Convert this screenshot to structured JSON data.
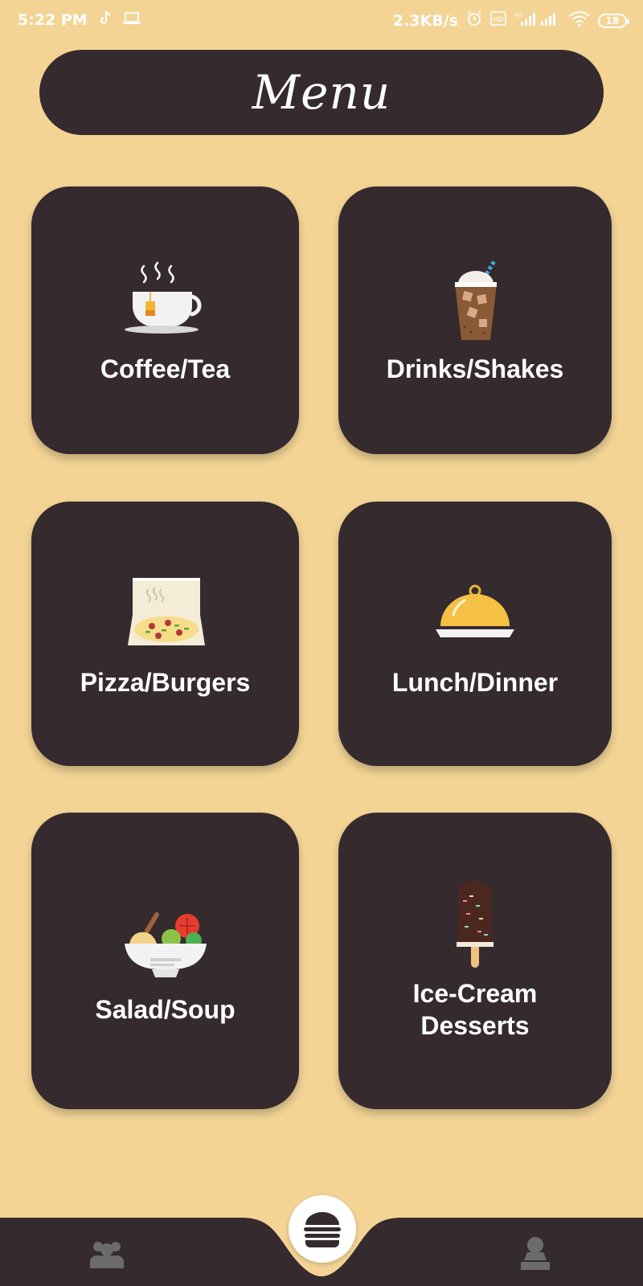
{
  "status_bar": {
    "time": "5:22 PM",
    "speed": "2.3KB/s",
    "network": "4G",
    "battery": "18",
    "icons": [
      "tiktok-icon",
      "laptop-icon",
      "alarm-icon",
      "volte-icon",
      "signal-icon",
      "wifi-icon",
      "battery-icon"
    ]
  },
  "header": {
    "title": "Menu"
  },
  "categories": [
    {
      "label": "Coffee/Tea",
      "icon": "teacup-icon"
    },
    {
      "label": "Drinks/Shakes",
      "icon": "iced-drink-icon"
    },
    {
      "label": "Pizza/Burgers",
      "icon": "pizza-box-icon"
    },
    {
      "label": "Lunch/Dinner",
      "icon": "cloche-icon"
    },
    {
      "label": "Salad/Soup",
      "icon": "salad-bowl-icon"
    },
    {
      "label": "Ice-Cream\nDesserts",
      "icon": "popsicle-icon"
    }
  ],
  "bottom_nav": {
    "left_icon": "group-icon",
    "center_icon": "burger-icon",
    "right_icon": "profile-icon"
  },
  "colors": {
    "background": "#f3d495",
    "card": "#352a2e",
    "text": "#ffffff"
  }
}
